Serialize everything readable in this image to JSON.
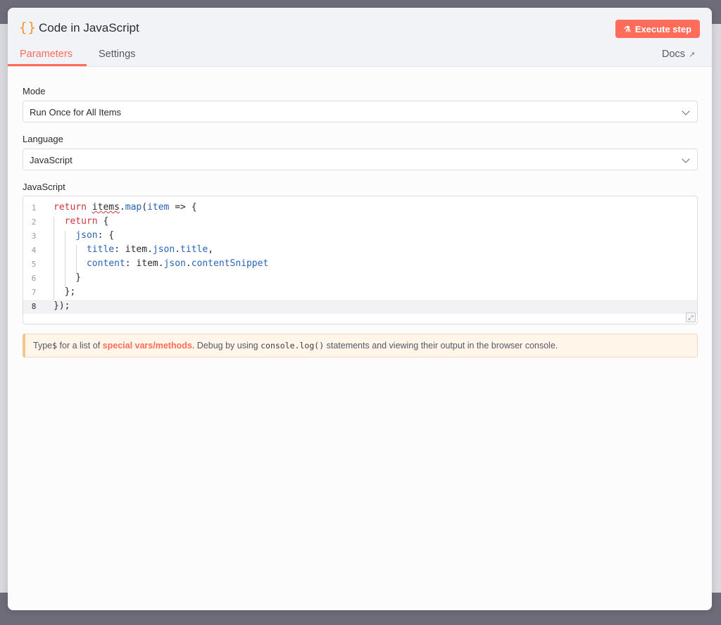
{
  "header": {
    "node_icon": "{}",
    "title": "Code in JavaScript",
    "execute_label": "Execute step",
    "tabs": [
      {
        "label": "Parameters",
        "active": true
      },
      {
        "label": "Settings",
        "active": false
      }
    ],
    "docs_label": "Docs"
  },
  "params": {
    "mode_label": "Mode",
    "mode_value": "Run Once for All Items",
    "language_label": "Language",
    "language_value": "JavaScript",
    "code_label": "JavaScript"
  },
  "editor": {
    "line_numbers": [
      "1",
      "2",
      "3",
      "4",
      "5",
      "6",
      "7",
      "8"
    ],
    "active_line": 8
  },
  "hint": {
    "part1": "Type ",
    "dollar": "$",
    "part2": " for a list of ",
    "link": "special vars/methods",
    "part3": ". Debug by using ",
    "code": "console.log()",
    "part4": " statements and viewing their output in the browser console."
  },
  "colors": {
    "accent": "#ff6d5a",
    "keyword": "#d1343b",
    "property": "#2763b5",
    "node_icon": "#f0932b"
  }
}
